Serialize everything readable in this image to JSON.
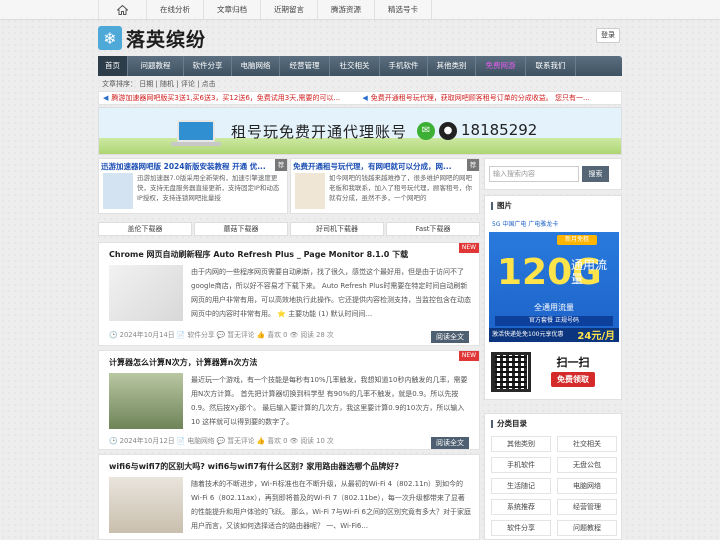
{
  "topnav": [
    {
      "label": "在线分析"
    },
    {
      "label": "文章归档"
    },
    {
      "label": "近期留言"
    },
    {
      "label": "腾游资源"
    },
    {
      "label": "精选号卡"
    }
  ],
  "site": {
    "title": "落英缤纷",
    "login": "登录"
  },
  "mainnav": [
    {
      "label": "首页",
      "active": true
    },
    {
      "label": "问题教程"
    },
    {
      "label": "软件分享"
    },
    {
      "label": "电脑网络"
    },
    {
      "label": "经营管理"
    },
    {
      "label": "社交相关"
    },
    {
      "label": "手机软件"
    },
    {
      "label": "其他类别"
    },
    {
      "label": "免费网游",
      "special": true
    },
    {
      "label": "联系我们"
    }
  ],
  "crumb": "文章排序：  日期 | 随机 | 评论 | 点击",
  "ticker": [
    "腾游加速器网吧版买3送1,买6送3，买12送6，免费试用3天,需要的可以...",
    "免费开通租号玩代理，获取网吧顾客租号订单的分成收益。 您只有一..."
  ],
  "banner": {
    "text": "租号玩免费开通代理账号",
    "phone": "18185292"
  },
  "features": [
    {
      "title": "迅游加速器网吧版 2024新版安装教程 开通 优...",
      "desc": "迅游加速器7.0版采用全新架构，加速引擎速度更快，支持无盘服务器直接更新，支持固定IP和动态IP授权，支持连锁网吧批量授",
      "tag": "荐"
    },
    {
      "title": "免费开通租号玩代理，有网吧就可以分成，网...",
      "desc": "如今网吧的钱越来越难挣了，很多维护网吧的网吧老板和我联系，加入了租号玩代理，顾客租号，你就有分成，虽然不多，一个网吧的",
      "tag": "荐"
    }
  ],
  "downloads": [
    "盖伦下载器",
    "蘑菇下载器",
    "好司机下载器",
    "Fast下载器"
  ],
  "posts": [
    {
      "title": "Chrome 网页自动刷新程序 Auto Refresh Plus _ Page Monitor 8.1.0 下载",
      "excerpt": "由于内网的一些程序网页需要自动刷新，找了很久，感觉这个最好用，但是由于访问不了google商店，所以好不容易才下载下来。 Auto Refresh Plus时需要在特定时间自动刷新网页的用户非常有用，可以高效地执行此操作。它还提供内容检测支持，当监控包含在动态网页中的内容时非常有用。 ⭐ 主要功能  (1) 默认时间间...",
      "meta": "🕒 2024年10月14日  📄 软件分享  💬 暂无评论  👍 喜欢 0  👁 阅读 28 次",
      "more": "阅读全文",
      "new": "NEW"
    },
    {
      "title": "计算器怎么计算N次方，计算器算n次方法",
      "excerpt": "最近玩一个游戏，有一个技能是每秒有10%几率触发，我想知道10秒内触发的几率，需要用N次方计算。 首先把计算器切换到科学型 有90%的几率不触发，就是0.9。所以先按0.9。然后按Xy那个。 最后输入要计算的几次方，我这里要计算0.9的10次方，所以输入10 这样就可以得到要的数字了。",
      "meta": "🕒 2024年10月12日  📄 电脑网络  💬 暂无评论  👍 喜欢 0  👁 阅读 10 次",
      "more": "阅读全文",
      "new": "NEW"
    },
    {
      "title": "wifi6与wifi7的区别大吗? wifi6与wifi7有什么区别? 家用路由器选哪个品牌好?",
      "excerpt": "随着技术的不断进步，Wi-Fi标准也在不断升级，从最初的Wi-Fi 4（802.11n）到如今的Wi-Fi 6（802.11ax），再到即将普及的Wi-Fi 7（802.11be），每一次升级都带来了显著的性能提升和用户体验的飞跃。 那么，Wi-Fi 7与Wi-Fi 6之间的区别究竟有多大？对于家庭用户而言，又该如何选择适合的路由器呢？ 一、Wi-Fi6..."
    }
  ],
  "sidebar": {
    "search_placeholder": "输入搜索内容",
    "search_btn": "搜索",
    "img_head": "图片",
    "ad": {
      "top": "5G 中国广电  广电雅龙卡",
      "badge": "新月免租",
      "big": "120G",
      "unit": "通用流量",
      "flow": "全通用流量",
      "line": "官方套餐 正规号码",
      "foot": "激活快递处免100元享优惠",
      "price": "24元/月"
    },
    "scan": {
      "s1": "扫一扫",
      "s2": "免费领取"
    },
    "cat_head": "分类目录",
    "cats": [
      "其他类别",
      "社交相关",
      "手机软件",
      "无盘公包",
      "生活随记",
      "电脑网络",
      "系统推荐",
      "经营管理",
      "软件分享",
      "问题教程"
    ]
  }
}
